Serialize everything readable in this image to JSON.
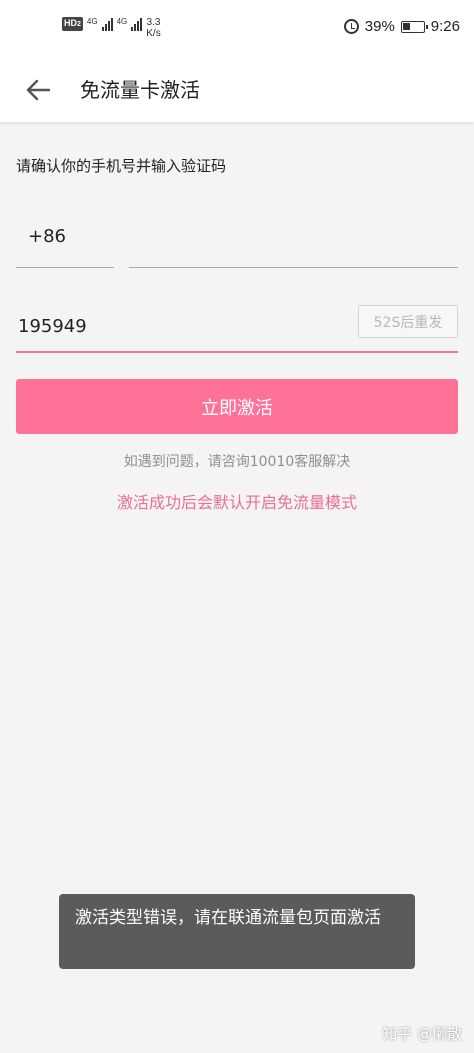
{
  "status_bar": {
    "hd_label": "HD",
    "hd_sub": "2",
    "network_1": "4G",
    "network_2": "4G",
    "speed_value": "3.3",
    "speed_unit": "K/s",
    "battery_percent": "39%",
    "battery_level": 0.39,
    "time": "9:26"
  },
  "header": {
    "title": "免流量卡激活",
    "back_icon": "arrow-left-icon"
  },
  "form": {
    "prompt": "请确认你的手机号并输入验证码",
    "country_code": "+86",
    "phone_value": "",
    "code_value": "195949",
    "resend_label": "52S后重发",
    "activate_label": "立即激活"
  },
  "help_text": "如遇到问题，请咨询10010客服解决",
  "notice": "激活成功后会默认开启免流量模式",
  "toast": "激活类型错误，请在联通流量包页面激活",
  "watermark": "知乎 @懒散",
  "colors": {
    "accent": "#fe7298",
    "accent_text": "#ea6f93",
    "background": "#f4f4f4"
  }
}
